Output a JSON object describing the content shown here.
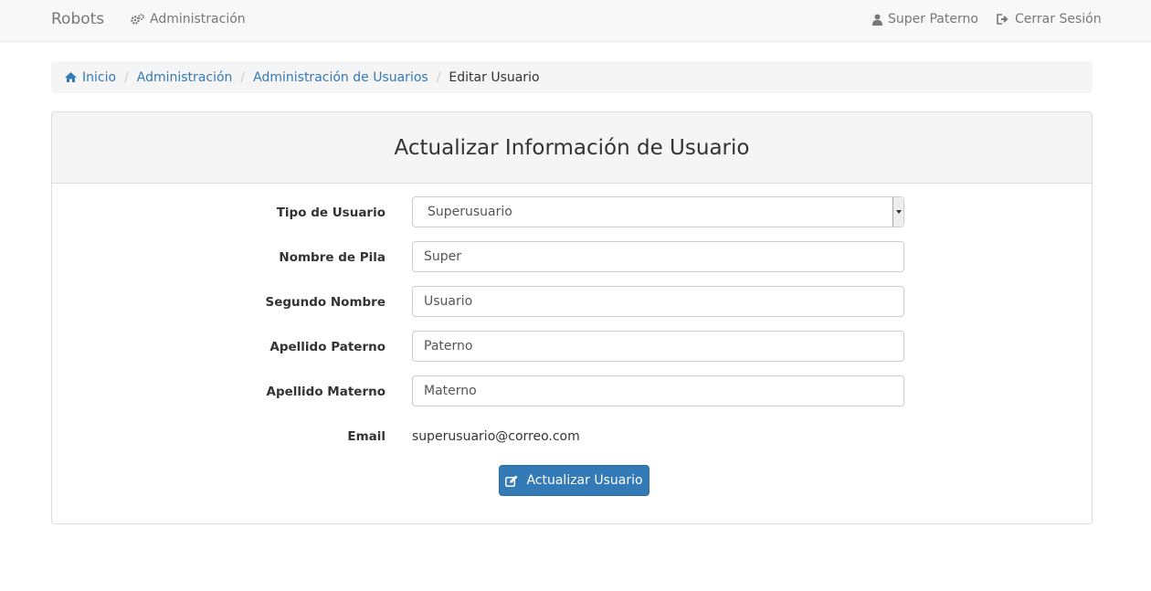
{
  "navbar": {
    "brand": "Robots",
    "admin_label": "Administración",
    "user_label": "Super Paterno",
    "logout_label": "Cerrar Sesión"
  },
  "breadcrumb": {
    "items": [
      "Inicio",
      "Administración",
      "Administración de Usuarios",
      "Editar Usuario"
    ]
  },
  "form": {
    "title": "Actualizar Información de Usuario",
    "fields": [
      {
        "label": "Tipo de Usuario",
        "value": "Superusuario"
      },
      {
        "label": "Nombre de Pila",
        "value": "Super"
      },
      {
        "label": "Segundo Nombre",
        "value": "Usuario"
      },
      {
        "label": "Apellido Paterno",
        "value": "Paterno"
      },
      {
        "label": "Apellido Materno",
        "value": "Materno"
      }
    ],
    "email_label": "Email",
    "email_value": "superusuario@correo.com",
    "submit_label": "Actualizar Usuario"
  },
  "icons": {
    "admin": "cogs-icon",
    "user": "user-icon",
    "logout": "sign-out-icon",
    "home": "home-icon",
    "submit": "edit-icon"
  },
  "colors": {
    "link": "#337ab7",
    "primary_button": "#337ab7",
    "navbar_bg": "#f8f8f8"
  }
}
